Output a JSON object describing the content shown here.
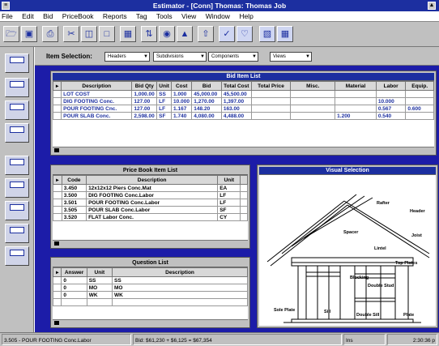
{
  "window": {
    "title": "Estimator - [Conn] Thomas: Thomas Job"
  },
  "menu": [
    "File",
    "Edit",
    "Bid",
    "PriceBook",
    "Reports",
    "Tag",
    "Tools",
    "View",
    "Window",
    "Help"
  ],
  "selection": {
    "label": "Item Selection:",
    "dropdowns": [
      "Headers",
      "Subdivisions",
      "Components",
      "Views"
    ]
  },
  "bid_list": {
    "title": "Bid Item List",
    "columns": [
      "",
      "Description",
      "Bid Qty",
      "Unit",
      "Cost",
      "Bid",
      "Total Cost",
      "Total Price",
      "Misc.",
      "Material",
      "Labor",
      "Equip."
    ],
    "rows": [
      [
        "",
        "LOT COST",
        "1,000.00",
        "SS",
        "1.000",
        "45,000.00",
        "45,500.00",
        "",
        "",
        "",
        "",
        ""
      ],
      [
        "",
        "DIG FOOTING  Conc.",
        "127.00",
        "LF",
        "10.000",
        "1,270.00",
        "1,397.00",
        "",
        "",
        "",
        "10.000",
        ""
      ],
      [
        "",
        "POUR FOOTING  Cnc.",
        "127.00",
        "LF",
        "1.167",
        "148.20",
        "163.00",
        "",
        "",
        "",
        "0.567",
        "0.600"
      ],
      [
        "",
        "POUR SLAB  Conc.",
        "2,598.00",
        "SF",
        "1.740",
        "4,080.00",
        "4,488.00",
        "",
        "",
        "1.200",
        "0.540",
        ""
      ]
    ]
  },
  "pricebook": {
    "title": "Price Book Item List",
    "columns": [
      "",
      "Code",
      "Description",
      "Unit"
    ],
    "rows": [
      [
        "",
        "3.450",
        "12x12x12 Piers Conc.Mat",
        "EA"
      ],
      [
        "",
        "3.500",
        "DIG FOOTING  Conc.Labor",
        "LF"
      ],
      [
        "",
        "3.501",
        "POUR FOOTING  Conc.Labor",
        "LF"
      ],
      [
        "",
        "3.505",
        "POUR SLAB  Conc.Labor",
        "SF"
      ],
      [
        "",
        "3.520",
        "FLAT Labor Conc.",
        "CY"
      ]
    ]
  },
  "questions": {
    "title": "Question List",
    "columns": [
      "",
      "Answer",
      "Unit",
      "Description"
    ],
    "rows": [
      [
        "",
        "0",
        "SS",
        "SS"
      ],
      [
        "",
        "0",
        "MO",
        "MO"
      ],
      [
        "",
        "0",
        "WK",
        "WK"
      ],
      [
        "",
        "",
        "",
        " "
      ]
    ]
  },
  "visual": {
    "title": "Visual Selection",
    "labels": [
      "Rafter",
      "Header",
      "Joist",
      "Top Plates",
      "Spacer",
      "Lintel",
      "Blocking",
      "Double Stud",
      "Sole Plate",
      "Sill",
      "Double Sill",
      "Plate"
    ]
  },
  "status": {
    "item": "3.505 - POUR FOOTING  Conc.Labor",
    "calc": "Bid: $61,230 + $6,125 = $67,354",
    "mode": "Ins",
    "time": "2:30:36 p"
  }
}
